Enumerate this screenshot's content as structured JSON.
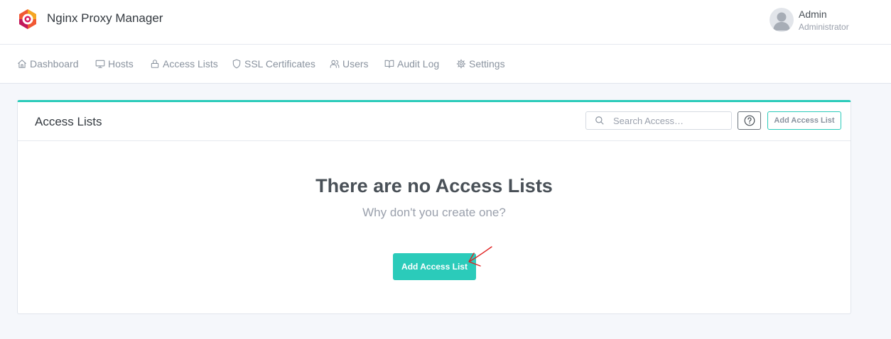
{
  "app": {
    "title": "Nginx Proxy Manager"
  },
  "user": {
    "name": "Admin",
    "role": "Administrator"
  },
  "nav": {
    "items": [
      {
        "label": "Dashboard",
        "icon": "home-icon"
      },
      {
        "label": "Hosts",
        "icon": "monitor-icon"
      },
      {
        "label": "Access Lists",
        "icon": "lock-icon"
      },
      {
        "label": "SSL Certificates",
        "icon": "shield-icon"
      },
      {
        "label": "Users",
        "icon": "users-icon"
      },
      {
        "label": "Audit Log",
        "icon": "book-icon"
      },
      {
        "label": "Settings",
        "icon": "gear-icon"
      }
    ]
  },
  "card": {
    "title": "Access Lists",
    "search_placeholder": "Search Access…",
    "add_button_label": "Add Access List",
    "empty_title": "There are no Access Lists",
    "empty_subtitle": "Why don't you create one?",
    "empty_add_button_label": "Add Access List"
  },
  "colors": {
    "accent": "#2bcbba",
    "annotation": "#e02020"
  }
}
